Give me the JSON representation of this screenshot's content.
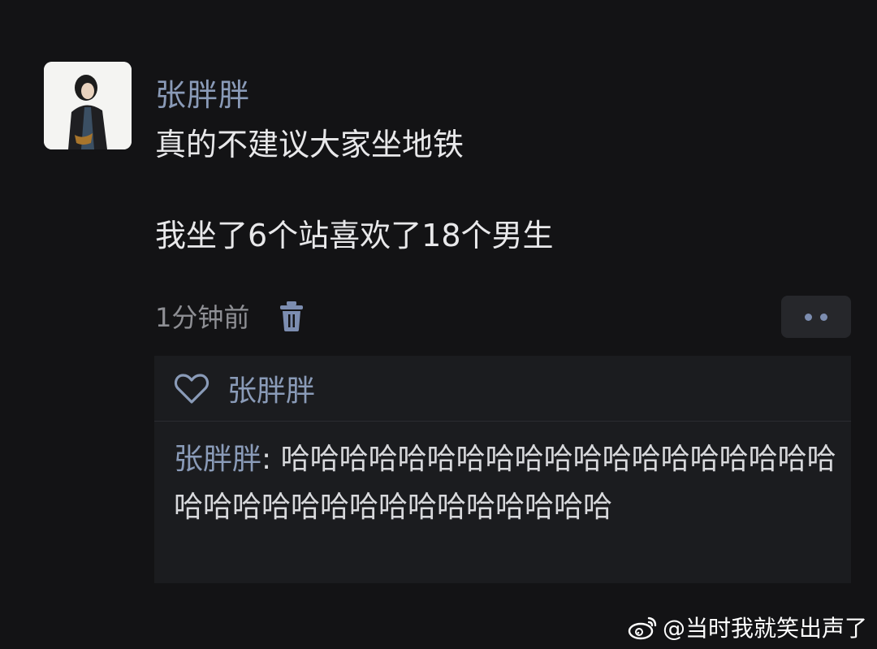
{
  "post": {
    "author": "张胖胖",
    "lines": [
      "真的不建议大家坐地铁",
      "",
      "我坐了6个站喜欢了18个男生"
    ],
    "timestamp": "1分钟前"
  },
  "likes": {
    "names": "张胖胖"
  },
  "comment": {
    "author": "张胖胖",
    "separator": ": ",
    "text": "哈哈哈哈哈哈哈哈哈哈哈哈哈哈哈哈哈哈哈哈哈哈哈哈哈哈哈哈哈哈哈哈哈哈"
  },
  "watermark": {
    "text": "@当时我就笑出声了"
  },
  "icons": {
    "delete": "trash-icon",
    "like": "heart-icon",
    "more": "more-dots-icon",
    "watermark": "weibo-logo-icon"
  },
  "colors": {
    "background": "#131315",
    "name": "#8a9bb8",
    "text": "#e8e8ea",
    "muted": "#8e8f94",
    "panel": "#1b1c1f"
  }
}
